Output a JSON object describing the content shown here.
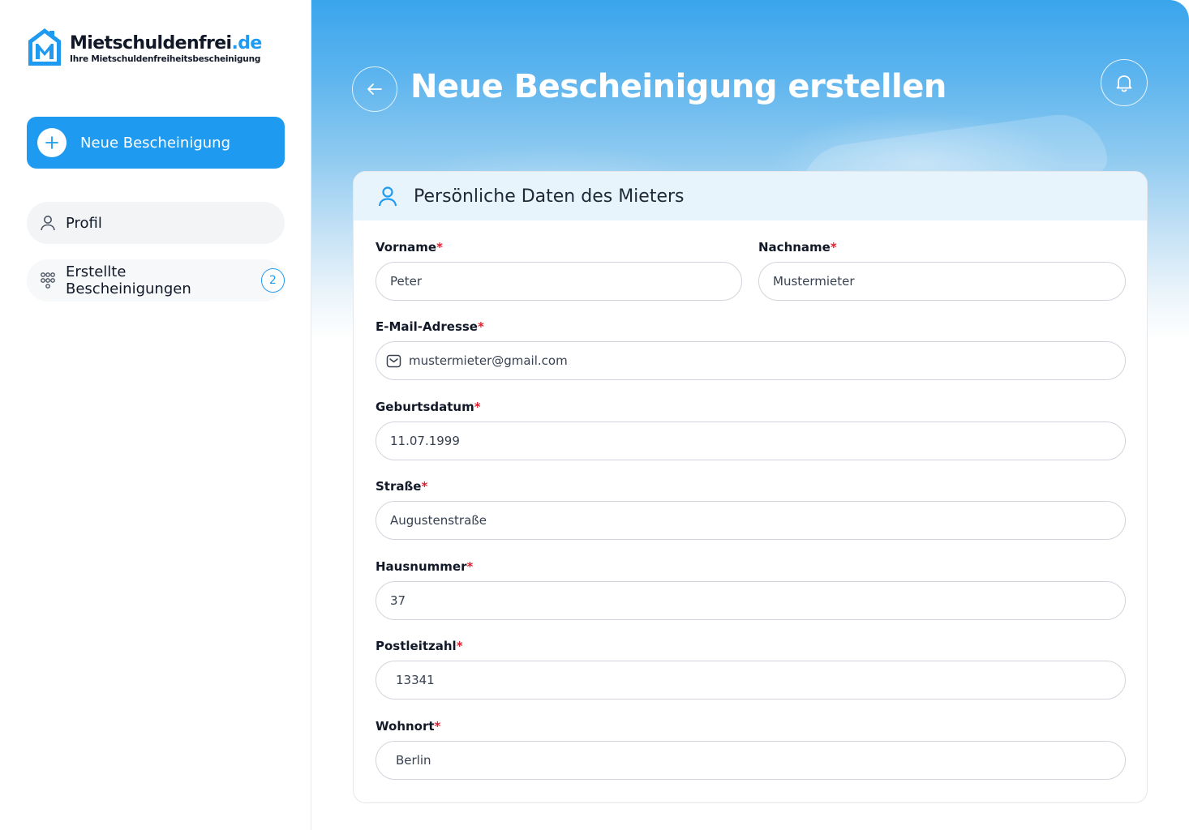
{
  "brand": {
    "name": "Mietschuldenfrei",
    "tld": ".de",
    "tagline": "Ihre Mietschuldenfreiheitsbescheinigung",
    "accent_color": "#1e9bf0"
  },
  "sidebar": {
    "new_button_label": "Neue Bescheinigung",
    "items": [
      {
        "label": "Profil",
        "icon": "user-icon"
      },
      {
        "label": "Erstellte Bescheinigungen",
        "icon": "documents-icon",
        "badge": "2"
      }
    ]
  },
  "header": {
    "title": "Neue Bescheinigung erstellen"
  },
  "form": {
    "section_title": "Persönliche Daten des Mieters",
    "required_marker": "*",
    "fields": {
      "vorname": {
        "label": "Vorname",
        "value": "Peter"
      },
      "nachname": {
        "label": "Nachname",
        "value": "Mustermieter"
      },
      "email": {
        "label": "E-Mail-Adresse",
        "value": "mustermieter@gmail.com"
      },
      "geburtsdatum": {
        "label": "Geburtsdatum",
        "value": "11.07.1999"
      },
      "strasse": {
        "label": "Straße",
        "value": "Augustenstraße"
      },
      "hausnummer": {
        "label": "Hausnummer",
        "value": "37"
      },
      "postleitzahl": {
        "label": "Postleitzahl",
        "value": "13341"
      },
      "wohnort": {
        "label": "Wohnort",
        "value": "Berlin"
      }
    }
  }
}
